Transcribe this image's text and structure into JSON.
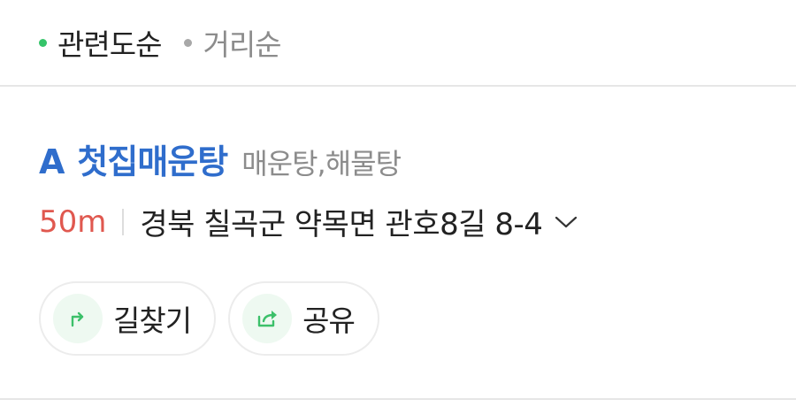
{
  "sort": {
    "options": [
      {
        "label": "관련도순",
        "selected": true
      },
      {
        "label": "거리순",
        "selected": false
      }
    ]
  },
  "result": {
    "marker": "A",
    "name": "첫집매운탕",
    "category": "매운탕,해물탕",
    "distance": "50m",
    "address": "경북 칠곡군 약목면 관호8길 8-4",
    "actions": {
      "directions_label": "길찾기",
      "share_label": "공유"
    }
  },
  "colors": {
    "accent_blue": "#2f6dcc",
    "distance_red": "#e0584f",
    "active_dot_green": "#35c46a",
    "icon_green": "#3cc06a"
  },
  "icons": {
    "expand": "chevron-down-icon",
    "directions": "turn-arrow-icon",
    "share": "share-arrow-icon"
  }
}
